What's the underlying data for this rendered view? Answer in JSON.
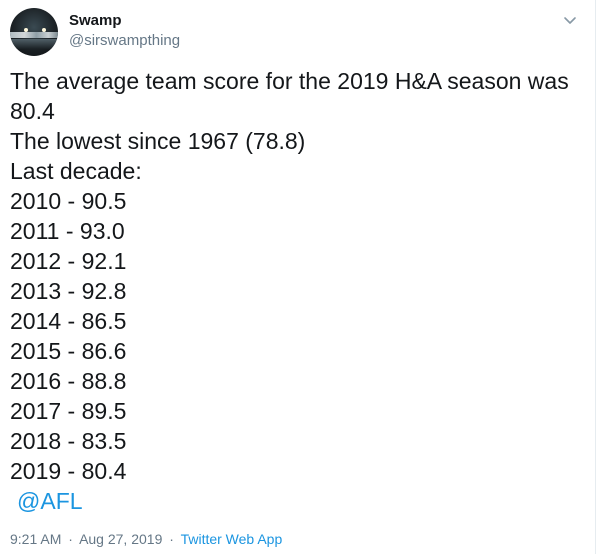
{
  "tweet": {
    "author": {
      "display_name": "Swamp",
      "handle": "@sirswampthing",
      "avatar_icon": "avatar-night-skyline"
    },
    "menu_icon": "chevron-down-icon",
    "lines": [
      "The average team score for the 2019 H&A season was",
      "80.4",
      "The lowest since 1967 (78.8)",
      "Last decade:",
      "2010 - 90.5",
      "2011 - 93.0",
      "2012 - 92.1",
      "2013 - 92.8",
      "2014 - 86.5",
      "2015 - 86.6",
      "2016 - 88.8",
      "2017 - 89.5",
      "2018 - 83.5",
      "2019 - 80.4"
    ],
    "mention": "@AFL",
    "time": "9:21 AM",
    "separator": "·",
    "date": "Aug 27, 2019",
    "source": "Twitter Web App"
  },
  "colors": {
    "text": "#14171a",
    "secondary": "#657786",
    "link": "#1b95e0",
    "background": "#ffffff"
  }
}
